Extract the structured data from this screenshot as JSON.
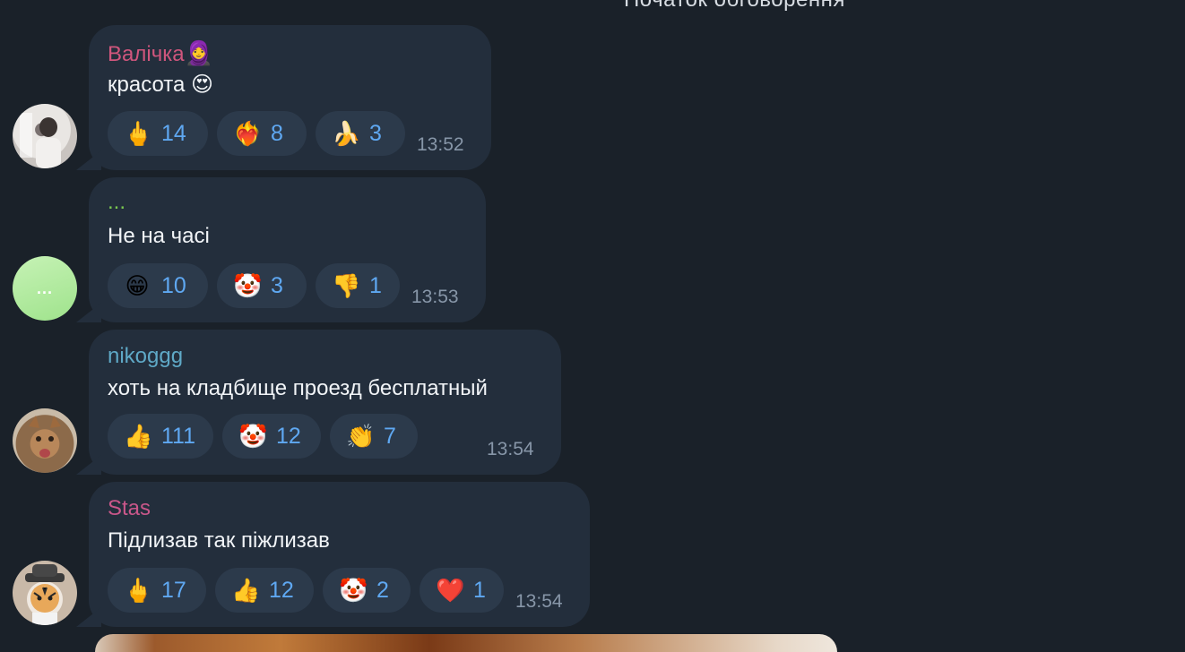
{
  "header": {
    "label": "Початок обговорення"
  },
  "messages": [
    {
      "author": "Валічка",
      "author_color": "#d0567d",
      "text": "красота 😍",
      "time": "13:52",
      "reactions": [
        {
          "icon": "middle-finger-icon",
          "emoji": "🖕",
          "count": "14"
        },
        {
          "icon": "broken-heart-fire-icon",
          "emoji": "❤️‍🔥",
          "count": "8"
        },
        {
          "icon": "banana-icon",
          "emoji": "🍌",
          "count": "3"
        }
      ]
    },
    {
      "author": "...",
      "author_color": "#7bc94f",
      "text": "Не на часі",
      "time": "13:53",
      "reactions": [
        {
          "icon": "grinning-face-icon",
          "emoji": "😁",
          "count": "10"
        },
        {
          "icon": "clown-face-icon",
          "emoji": "🤡",
          "count": "3"
        },
        {
          "icon": "thumbs-down-icon",
          "emoji": "👎",
          "count": "1"
        }
      ]
    },
    {
      "author": "nikoggg",
      "author_color": "#5fa9c7",
      "text": "хоть на кладбище проезд бесплатный",
      "time": "13:54",
      "reactions": [
        {
          "icon": "thumbs-up-icon",
          "emoji": "👍",
          "count": "111"
        },
        {
          "icon": "clown-face-icon",
          "emoji": "🤡",
          "count": "12"
        },
        {
          "icon": "clapping-hands-icon",
          "emoji": "👏",
          "count": "7"
        }
      ]
    },
    {
      "author": "Stas",
      "author_color": "#c9578a",
      "text": "Підлизав так піжлизав",
      "time": "13:54",
      "reactions": [
        {
          "icon": "middle-finger-icon",
          "emoji": "🖕",
          "count": "17"
        },
        {
          "icon": "thumbs-up-icon",
          "emoji": "👍",
          "count": "12"
        },
        {
          "icon": "clown-face-icon",
          "emoji": "🤡",
          "count": "2"
        },
        {
          "icon": "red-heart-icon",
          "emoji": "❤️",
          "count": "1"
        }
      ]
    }
  ]
}
